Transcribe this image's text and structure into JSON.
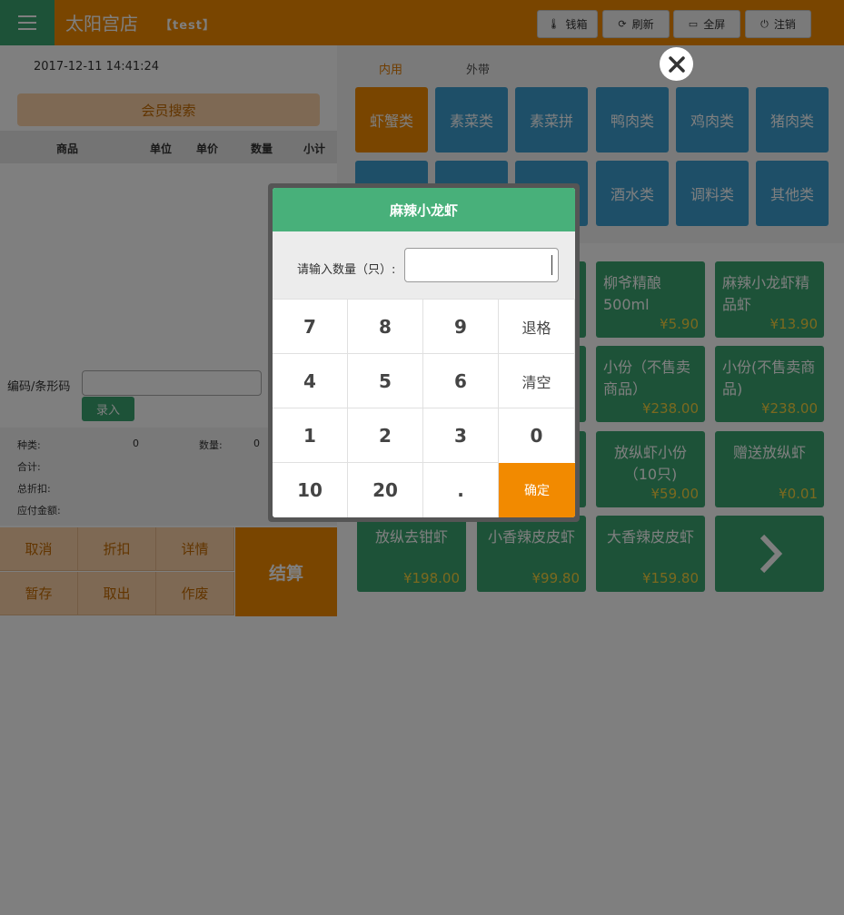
{
  "header": {
    "store_name": "太阳宫店",
    "store_tag": "【test】",
    "buttons": [
      {
        "label": "钱箱",
        "icon": "cash-drawer-icon"
      },
      {
        "label": "刷新",
        "icon": "refresh-icon"
      },
      {
        "label": "全屏",
        "icon": "fullscreen-icon"
      },
      {
        "label": "注销",
        "icon": "power-icon"
      }
    ]
  },
  "left": {
    "datetime": "2017-12-11 14:41:24",
    "member_search": "会员搜索",
    "columns": [
      "商品",
      "单位",
      "单价",
      "数量",
      "小计"
    ],
    "barcode_label": "编码/条形码",
    "barcode_value": "",
    "enter_button": "录入",
    "summary": {
      "kinds_label": "种类:",
      "kinds_value": "0",
      "count_label": "数量:",
      "count_value": "0",
      "total_label": "合计:",
      "discount_label": "总折扣:",
      "payable_label": "应付金额:"
    },
    "actions": [
      "取消",
      "折扣",
      "详情",
      "暂存",
      "取出",
      "作废"
    ],
    "settle": "结算"
  },
  "right": {
    "tabs": [
      "内用",
      "外带"
    ],
    "categories": [
      "虾蟹类",
      "素菜类",
      "素菜拼",
      "鸭肉类",
      "鸡肉类",
      "猪肉类",
      "",
      "",
      "",
      "酒水类",
      "调料类",
      "其他类"
    ],
    "products": [
      {
        "name": "柳爷精酿500ml",
        "price": "¥5.90"
      },
      {
        "name": "麻辣小龙虾精品虾",
        "price": "¥13.90"
      },
      {
        "name": "小份（不售卖商品）",
        "price": "¥238.00"
      },
      {
        "name": "小份(不售卖商品)",
        "price": "¥238.00"
      },
      {
        "name": "放纵虾小份（10只)",
        "price": "¥59.00"
      },
      {
        "name": "赠送放纵虾",
        "price": "¥0.01"
      },
      {
        "name": "放纵去钳虾",
        "price": "¥198.00"
      },
      {
        "name": "小香辣皮皮虾",
        "price": "¥99.80"
      },
      {
        "name": "大香辣皮皮虾",
        "price": "¥159.80"
      }
    ]
  },
  "modal": {
    "title": "麻辣小龙虾",
    "qty_label": "请输入数量（只）:",
    "qty_value": "",
    "keys": [
      "7",
      "8",
      "9",
      "退格",
      "4",
      "5",
      "6",
      "清空",
      "1",
      "2",
      "3",
      "0",
      "10",
      "20",
      ".",
      "确定"
    ]
  },
  "colors": {
    "header": "#f28a00",
    "green": "#3aa571",
    "category_blue": "#3d9fd0",
    "modal_title": "#48b07a",
    "price_yellow": "#f6d23e"
  }
}
